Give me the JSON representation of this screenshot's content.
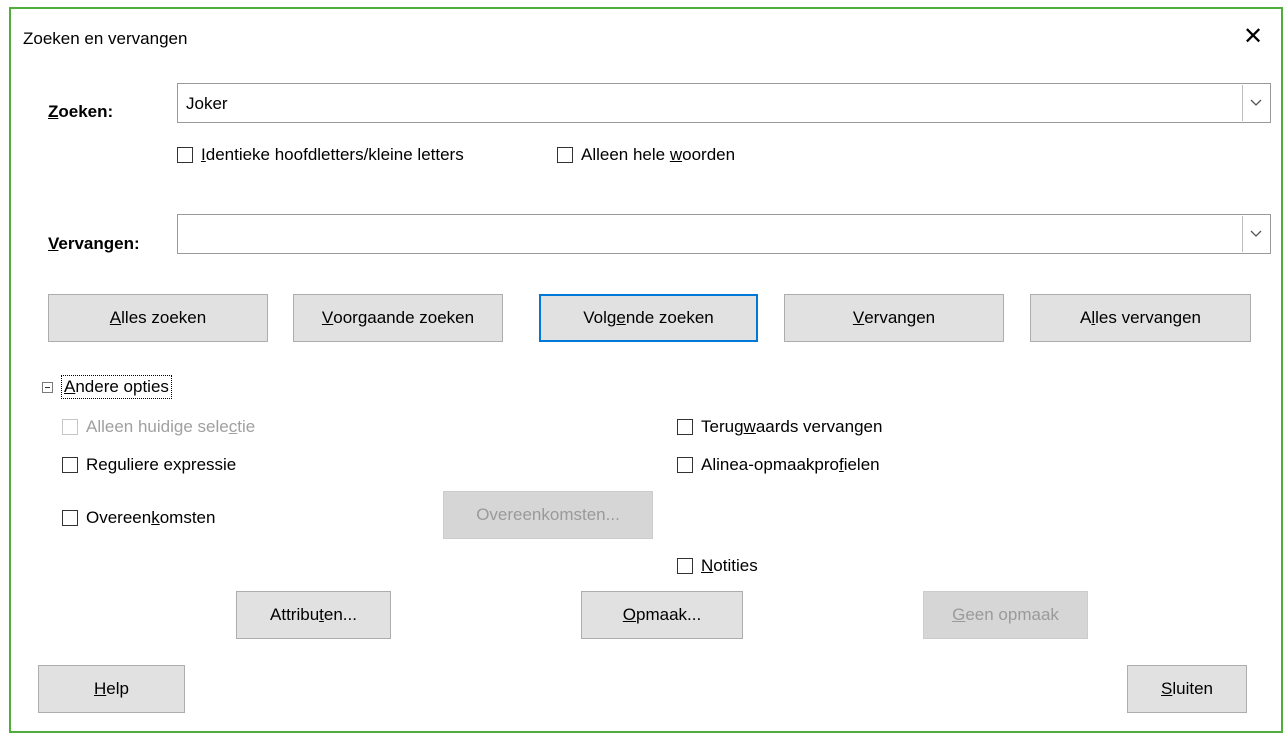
{
  "window": {
    "title": "Zoeken en vervangen",
    "close_glyph": "✕"
  },
  "search": {
    "label_u": "Z",
    "label_rest": "oeken:",
    "value": "Joker",
    "match_case": {
      "pre": "",
      "u": "I",
      "post": "dentieke hoofdletters/kleine letters",
      "checked": false
    },
    "whole_words": {
      "pre": "Alleen hele ",
      "u": "w",
      "post": "oorden",
      "checked": false
    }
  },
  "replace": {
    "label_u": "V",
    "label_rest": "ervangen:",
    "value": ""
  },
  "actions": {
    "find_all": {
      "pre": "",
      "u": "A",
      "post": "lles zoeken"
    },
    "find_prev": {
      "pre": "",
      "u": "V",
      "post": "oorgaande zoeken"
    },
    "find_next": {
      "pre": "Volg",
      "u": "e",
      "post": "nde zoeken"
    },
    "replace_one": {
      "pre": "",
      "u": "V",
      "post": "ervangen"
    },
    "replace_all": {
      "pre": "A",
      "u": "l",
      "post": "les vervangen"
    }
  },
  "other_options": {
    "header_u": "A",
    "header_rest": "ndere opties",
    "current_selection": {
      "pre": "Alleen huidige sele",
      "u": "c",
      "post": "tie",
      "checked": false,
      "disabled": true
    },
    "regex": {
      "pre": "Re",
      "u": "g",
      "post": "uliere expressie",
      "checked": false
    },
    "similarity": {
      "pre": "Overeen",
      "u": "k",
      "post": "omsten",
      "checked": false
    },
    "similarity_button": "Overeenkomsten...",
    "backwards": {
      "pre": "Terug",
      "u": "w",
      "post": "aards vervangen",
      "checked": false
    },
    "para_styles": {
      "pre": "Alinea-opmaakpro",
      "u": "f",
      "post": "ielen",
      "checked": false
    },
    "comments": {
      "pre": "",
      "u": "N",
      "post": "otities",
      "checked": false
    },
    "attributes_button": {
      "pre": "Attribu",
      "u": "t",
      "post": "en..."
    },
    "format_button": {
      "pre": "",
      "u": "O",
      "post": "pmaak..."
    },
    "no_format_button": {
      "pre": "",
      "u": "G",
      "post": "een opmaak"
    }
  },
  "footer": {
    "help": {
      "pre": "",
      "u": "H",
      "post": "elp"
    },
    "close": {
      "pre": "",
      "u": "S",
      "post": "luiten"
    }
  },
  "icons": {
    "dropdown": "chevron-down-icon",
    "collapse": "minus-box-icon"
  },
  "colors": {
    "window_border": "#4fae3c",
    "focus_border": "#0078d7",
    "button_bg": "#e1e1e1"
  }
}
